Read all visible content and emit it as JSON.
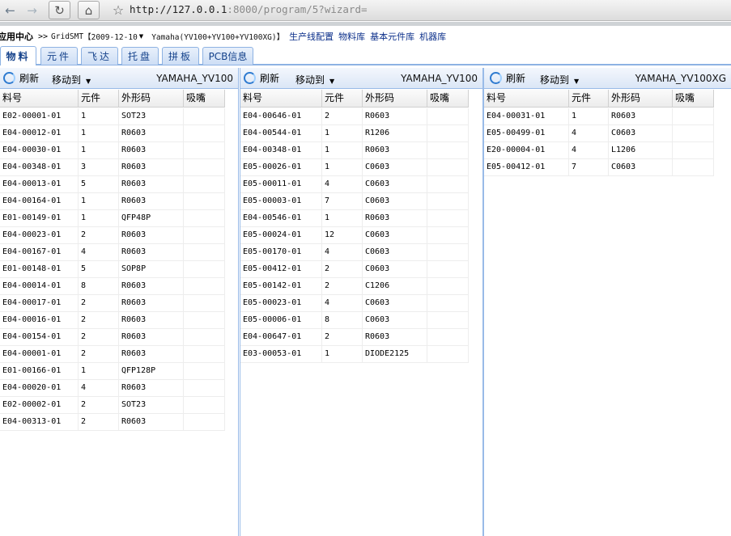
{
  "browser": {
    "url_host": "http://127.0.0.1",
    "url_rest": ":8000/program/5?wizard="
  },
  "breadcrumb": {
    "root": "应用中心",
    "sep": ">>",
    "app": "GridSMT",
    "date": "【2009-12-10",
    "machine": "Yamaha(YV100+YV100+YV100XG)】",
    "links": [
      "生产线配置",
      "物料库",
      "基本元件库",
      "机器库"
    ]
  },
  "tabs": [
    "物料",
    "元件",
    "飞达",
    "托盘",
    "拼板",
    "PCB信息"
  ],
  "toolbar": {
    "refresh": "刷新",
    "move_to": "移动到"
  },
  "columns": [
    "料号",
    "元件",
    "外形码",
    "吸嘴"
  ],
  "panels": [
    {
      "title": "YAMAHA_YV100",
      "rows": [
        [
          "E02-00001-01",
          "1",
          "SOT23",
          ""
        ],
        [
          "E04-00012-01",
          "1",
          "R0603",
          ""
        ],
        [
          "E04-00030-01",
          "1",
          "R0603",
          ""
        ],
        [
          "E04-00348-01",
          "3",
          "R0603",
          ""
        ],
        [
          "E04-00013-01",
          "5",
          "R0603",
          ""
        ],
        [
          "E04-00164-01",
          "1",
          "R0603",
          ""
        ],
        [
          "E01-00149-01",
          "1",
          "QFP48P",
          ""
        ],
        [
          "E04-00023-01",
          "2",
          "R0603",
          ""
        ],
        [
          "E04-00167-01",
          "4",
          "R0603",
          ""
        ],
        [
          "E01-00148-01",
          "5",
          "SOP8P",
          ""
        ],
        [
          "E04-00014-01",
          "8",
          "R0603",
          ""
        ],
        [
          "E04-00017-01",
          "2",
          "R0603",
          ""
        ],
        [
          "E04-00016-01",
          "2",
          "R0603",
          ""
        ],
        [
          "E04-00154-01",
          "2",
          "R0603",
          ""
        ],
        [
          "E04-00001-01",
          "2",
          "R0603",
          ""
        ],
        [
          "E01-00166-01",
          "1",
          "QFP128P",
          ""
        ],
        [
          "E04-00020-01",
          "4",
          "R0603",
          ""
        ],
        [
          "E02-00002-01",
          "2",
          "SOT23",
          ""
        ],
        [
          "E04-00313-01",
          "2",
          "R0603",
          ""
        ]
      ]
    },
    {
      "title": "YAMAHA_YV100",
      "rows": [
        [
          "E04-00646-01",
          "2",
          "R0603",
          ""
        ],
        [
          "E04-00544-01",
          "1",
          "R1206",
          ""
        ],
        [
          "E04-00348-01",
          "1",
          "R0603",
          ""
        ],
        [
          "E05-00026-01",
          "1",
          "C0603",
          ""
        ],
        [
          "E05-00011-01",
          "4",
          "C0603",
          ""
        ],
        [
          "E05-00003-01",
          "7",
          "C0603",
          ""
        ],
        [
          "E04-00546-01",
          "1",
          "R0603",
          ""
        ],
        [
          "E05-00024-01",
          "12",
          "C0603",
          ""
        ],
        [
          "E05-00170-01",
          "4",
          "C0603",
          ""
        ],
        [
          "E05-00412-01",
          "2",
          "C0603",
          ""
        ],
        [
          "E05-00142-01",
          "2",
          "C1206",
          ""
        ],
        [
          "E05-00023-01",
          "4",
          "C0603",
          ""
        ],
        [
          "E05-00006-01",
          "8",
          "C0603",
          ""
        ],
        [
          "E04-00647-01",
          "2",
          "R0603",
          ""
        ],
        [
          "E03-00053-01",
          "1",
          "DIODE2125",
          ""
        ]
      ]
    },
    {
      "title": "YAMAHA_YV100XG",
      "rows": [
        [
          "E04-00031-01",
          "1",
          "R0603",
          ""
        ],
        [
          "E05-00499-01",
          "4",
          "C0603",
          ""
        ],
        [
          "E20-00004-01",
          "4",
          "L1206",
          ""
        ],
        [
          "E05-00412-01",
          "7",
          "C0603",
          ""
        ]
      ]
    }
  ]
}
